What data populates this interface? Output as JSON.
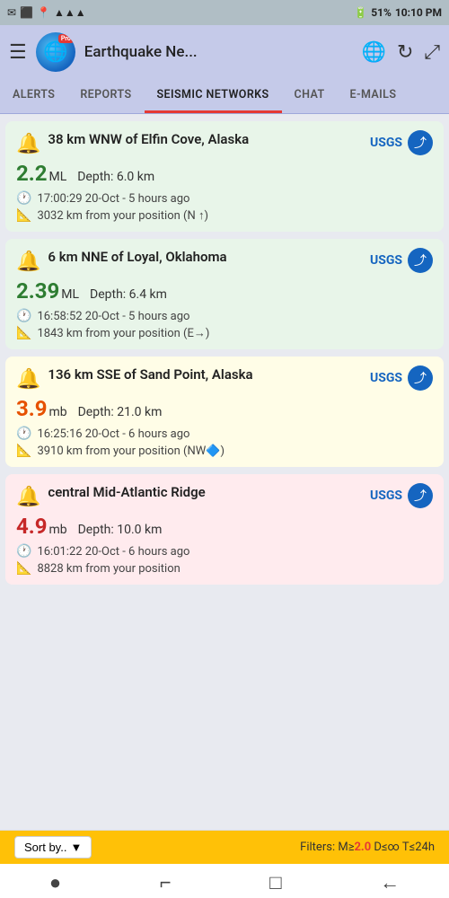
{
  "statusBar": {
    "left_icons": [
      "✉",
      "⬛",
      "📶"
    ],
    "signal": "📶",
    "battery": "51%",
    "time": "10:10 PM",
    "wifi": "WiFi",
    "location": "📍"
  },
  "header": {
    "title": "Earthquake Ne...",
    "menu_icon": "☰",
    "globe_icon": "🌐",
    "refresh_icon": "↻",
    "expand_icon": "⤢",
    "pro_badge": "Pro"
  },
  "tabs": [
    {
      "id": "alerts",
      "label": "ALERTS",
      "active": false
    },
    {
      "id": "reports",
      "label": "REPORTS",
      "active": false
    },
    {
      "id": "seismic",
      "label": "SEISMIC NETWORKS",
      "active": true
    },
    {
      "id": "chat",
      "label": "CHAT",
      "active": false
    },
    {
      "id": "emails",
      "label": "E-MAILS",
      "active": false
    }
  ],
  "earthquakes": [
    {
      "id": "eq1",
      "color": "green",
      "title": "38 km WNW of Elfin Cove, Alaska",
      "source": "USGS",
      "magnitude": "2.2",
      "mag_type": "ML",
      "depth_label": "Depth:",
      "depth_value": "6.0 km",
      "time": "17:00:29 20-Oct - 5 hours ago",
      "distance": "3032 km from your position (N ↑)",
      "mag_class": "green-mag"
    },
    {
      "id": "eq2",
      "color": "green",
      "title": "6 km NNE of Loyal, Oklahoma",
      "source": "USGS",
      "magnitude": "2.39",
      "mag_type": "ML",
      "depth_label": "Depth:",
      "depth_value": "6.4 km",
      "time": "16:58:52 20-Oct - 5 hours ago",
      "distance": "1843 km from your position (E→)",
      "mag_class": "green-mag"
    },
    {
      "id": "eq3",
      "color": "yellow",
      "title": "136 km SSE of Sand Point, Alaska",
      "source": "USGS",
      "magnitude": "3.9",
      "mag_type": "mb",
      "depth_label": "Depth:",
      "depth_value": "21.0 km",
      "time": "16:25:16 20-Oct - 6 hours ago",
      "distance": "3910 km from your position (NW🔷)",
      "mag_class": "orange-mag"
    },
    {
      "id": "eq4",
      "color": "red-light",
      "title": "central Mid-Atlantic Ridge",
      "source": "USGS",
      "magnitude": "4.9",
      "mag_type": "mb",
      "depth_label": "Depth:",
      "depth_value": "10.0 km",
      "time": "16:01:22 20-Oct - 6 hours ago",
      "distance": "8828 km from your position",
      "mag_class": "red-mag"
    }
  ],
  "bottomBar": {
    "sort_label": "Sort by..",
    "filter_label": "Filters: M≥",
    "filter_mag": "2.0",
    "filter_rest": " D≤∞ T≤24h"
  },
  "nav": {
    "dot_icon": "●",
    "corner_icon": "⌐",
    "square_icon": "□",
    "back_icon": "←"
  }
}
